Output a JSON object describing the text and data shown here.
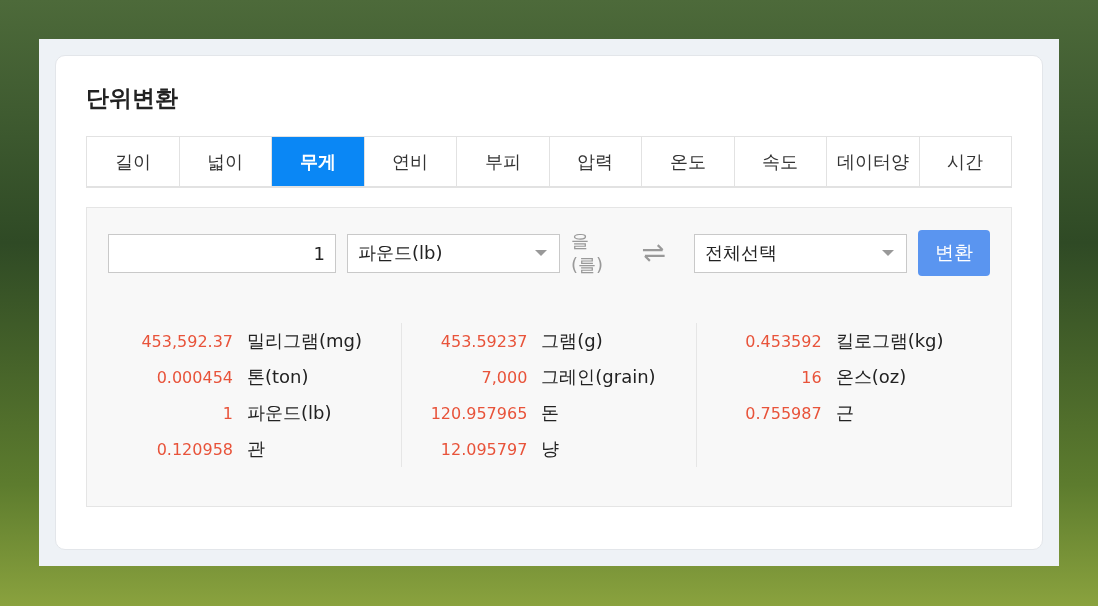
{
  "title": "단위변환",
  "tabs": [
    {
      "label": "길이",
      "selected": false
    },
    {
      "label": "넓이",
      "selected": false
    },
    {
      "label": "무게",
      "selected": true
    },
    {
      "label": "연비",
      "selected": false
    },
    {
      "label": "부피",
      "selected": false
    },
    {
      "label": "압력",
      "selected": false
    },
    {
      "label": "온도",
      "selected": false
    },
    {
      "label": "속도",
      "selected": false
    },
    {
      "label": "데이터양",
      "selected": false
    },
    {
      "label": "시간",
      "selected": false
    }
  ],
  "converter": {
    "amount": "1",
    "from_unit": "파운드(lb)",
    "particle": "을(를)",
    "to_unit": "전체선택",
    "button": "변환"
  },
  "results": [
    [
      {
        "value": "453,592.37",
        "unit": "밀리그램(mg)"
      },
      {
        "value": "0.000454",
        "unit": "톤(ton)"
      },
      {
        "value": "1",
        "unit": "파운드(lb)"
      },
      {
        "value": "0.120958",
        "unit": "관"
      }
    ],
    [
      {
        "value": "453.59237",
        "unit": "그램(g)"
      },
      {
        "value": "7,000",
        "unit": "그레인(grain)"
      },
      {
        "value": "120.957965",
        "unit": "돈"
      },
      {
        "value": "12.095797",
        "unit": "냥"
      }
    ],
    [
      {
        "value": "0.453592",
        "unit": "킬로그램(kg)"
      },
      {
        "value": "16",
        "unit": "온스(oz)"
      },
      {
        "value": "0.755987",
        "unit": "근"
      }
    ]
  ]
}
